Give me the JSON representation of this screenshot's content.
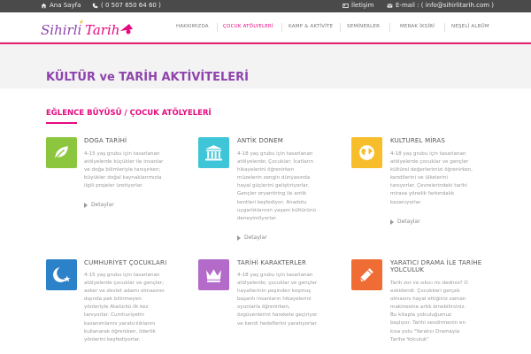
{
  "colors": {
    "accent": "#e5097f",
    "title": "#8e44ad",
    "topbar": "#4a4a4a",
    "green": "#8cc63f",
    "cyan": "#3ec6d8",
    "yellow": "#f7bd2b",
    "blue": "#2c82c9",
    "purple": "#b36ac9",
    "orange": "#f06c35"
  },
  "topbar": {
    "home": "Ana Sayfa",
    "phone": "( 0 507 650 64 60 )",
    "contact": "İletişim",
    "email": "E-mail : ( info@sihirlitarih.com )"
  },
  "logo": {
    "text": "Sihirli Tarih",
    "icon": "magic-hat-logo"
  },
  "nav": [
    "HAKKIMIZDA",
    "ÇOCUK ATÖLYELERİ",
    "KAMP & AKTİVİTE",
    "SEMİNERLER",
    "MERAK İKSİRİ",
    "NEŞELİ ALBÜM"
  ],
  "page_title": "KÜLTÜR ve TARİH AKTİVİTELERİ",
  "section_title": "EĞLENCE BÜYÜSÜ / ÇOCUK ATÖLYELERİ",
  "more_label": "Detaylar",
  "cards": [
    {
      "title": "DOGA TARİHİ",
      "icon": "leaf-icon",
      "lines": [
        "4-15 yaş grubu için tasarlanan",
        "atölyelerde küçükler ile insanlar",
        "ve doğa bilimleriyle tanışırken;",
        "büyükler doğal kaynaklarımızla",
        "ilgili projeler üretiyorlar."
      ]
    },
    {
      "title": "ANTİK DONEM",
      "icon": "temple-icon",
      "lines": [
        "4-18 yaş grubu için tasarlanan",
        "atölyelerde; Çocuklar; İcatların",
        "hikayelerini öğrenirken",
        "müzelerin zengin dünyasında",
        "hayal güçlerini geliştiriyorlar.",
        "Gençler oryantiring ile antik",
        "kentleri keşfediyor, Anadolu",
        "uygarlıklarının yaşam kültürünü",
        "deneyimliyorlar."
      ]
    },
    {
      "title": "KULTUREL MİRAS",
      "icon": "globe-icon",
      "lines": [
        "4-18 yaş grubu için tasarlanan",
        "atölyelerde çocuklar ve gençler",
        "kültürel değerlerimizi öğrenirken,",
        "kendilerini ve ülkelerini",
        "tanıyorlar. Çevrelerindeki tarihi",
        "mirasa yönelik farkındalık",
        "kazanıyorlar."
      ]
    },
    {
      "title": "CUMHURİYET ÇOCUKLARI",
      "icon": "crescent-moon-icon",
      "lines": [
        "4-15 yaş grubu için tasarlanan",
        "atölyelerde çocuklar ve gençler;",
        "asker ve devlet adamı olmasının",
        "dışında pek bilinmeyen",
        "yönleriyle Atatürkü ilk kez",
        "tanıyorlar. Cumhuriyetin",
        "kazanımlarını yaratıcılıklarını",
        "kullanarak öğreniken, liderlik",
        "yönlerini keşfediyorlar."
      ]
    },
    {
      "title": "TARİHİ KARAKTERLER",
      "icon": "crown-icon",
      "lines": [
        "4-18 yaş grubu için tasarlanan",
        "atölyelerde; çocuklar ve gençler",
        "hayallerinin peşinden koşmuş",
        "başarılı insanların hikayelerini",
        "oyunlarla öğrenirken,",
        "özgüvenlerini harekete geçiriyor",
        "ve kendi hedeflerini yaratıyorlar."
      ]
    },
    {
      "title": "YARATICI DRAMA İLE TARİHE YOLCULUK",
      "icon": "pencil-icon",
      "lines": [
        "Tarih zor ve sıkıcı mı dediniz? O",
        "eskidendi. Çocukkeri gerçek",
        "olmasını hayal ettiğiniz zaman",
        "makinesine artık binebilirsiniz.",
        "Bu kitapla yolculuğumuz",
        "başlıyor. Tarihi sevdirmenin en",
        "kısa yolu \"Yaratıcı Dramayla",
        "Tarihe Yolculuk\""
      ]
    }
  ]
}
